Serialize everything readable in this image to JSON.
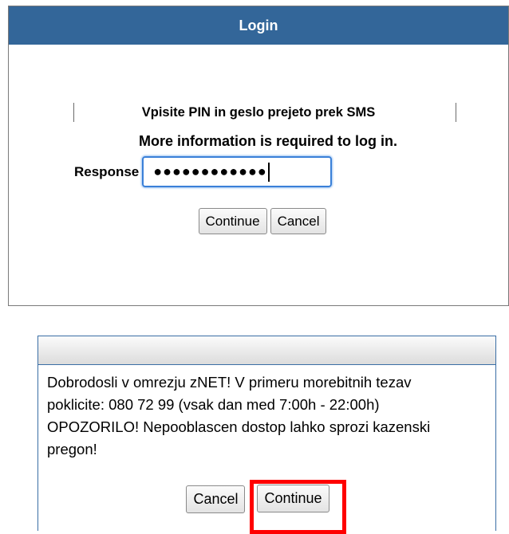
{
  "login": {
    "title": "Login",
    "prompt_line1": "Vpisite PIN in geslo prejeto prek SMS",
    "prompt_line2": "More information is required to log in.",
    "response_label": "Response",
    "response_value": "●●●●●●●●●●●●",
    "continue_label": "Continue",
    "cancel_label": "Cancel"
  },
  "notice": {
    "title": "",
    "message": "Dobrodosli v omrezju zNET! V primeru morebitnih tezav poklicite: 080 72 99 (vsak dan med 7:00h - 22:00h) OPOZORILO! Nepooblascen dostop lahko sprozi kazenski pregon!",
    "cancel_label": "Cancel",
    "continue_label": "Continue",
    "highlight_color": "#ff0000"
  },
  "colors": {
    "header_blue": "#336699",
    "focus_blue": "#3a80d8"
  }
}
